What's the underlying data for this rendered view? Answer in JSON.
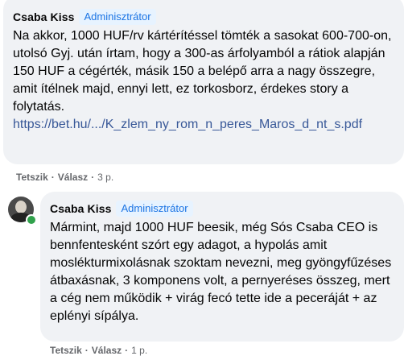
{
  "comment1": {
    "author": "Csaba Kiss",
    "role": "Adminisztrátor",
    "text": "Na akkor, 1000 HUF/rv kártérítéssel tömték a sasokat 600-700-on, utolsó Gyj. után írtam, hogy a 300-as árfolyamból a rátiok alapján 150 HUF a cégérték, másik 150 a belépő arra a nagy összegre, amit ítélnek majd, ennyi lett, ez torkosborz, érdekes story a folytatás.",
    "link": "https://bet.hu/.../K_zlem_ny_rom_n_peres_Maros_d_nt_s.pdf",
    "actions": {
      "like": "Tetszik",
      "reply": "Válasz",
      "time": "3 p."
    }
  },
  "comment2": {
    "author": "Csaba Kiss",
    "role": "Adminisztrátor",
    "text": "Mármint, majd 1000 HUF beesik, még Sós Csaba CEO is bennfentesként szórt egy adagot, a hypolás amit moslékturmixolásnak szoktam nevezni, meg gyöngyfűzéses átbaxásnak, 3 komponens volt, a pernyeréses összeg, mert a cég nem működik + virág fecó tette ide a peceráját + az eplényi sípálya.",
    "actions": {
      "like": "Tetszik",
      "reply": "Válasz",
      "time": "1 p."
    }
  }
}
